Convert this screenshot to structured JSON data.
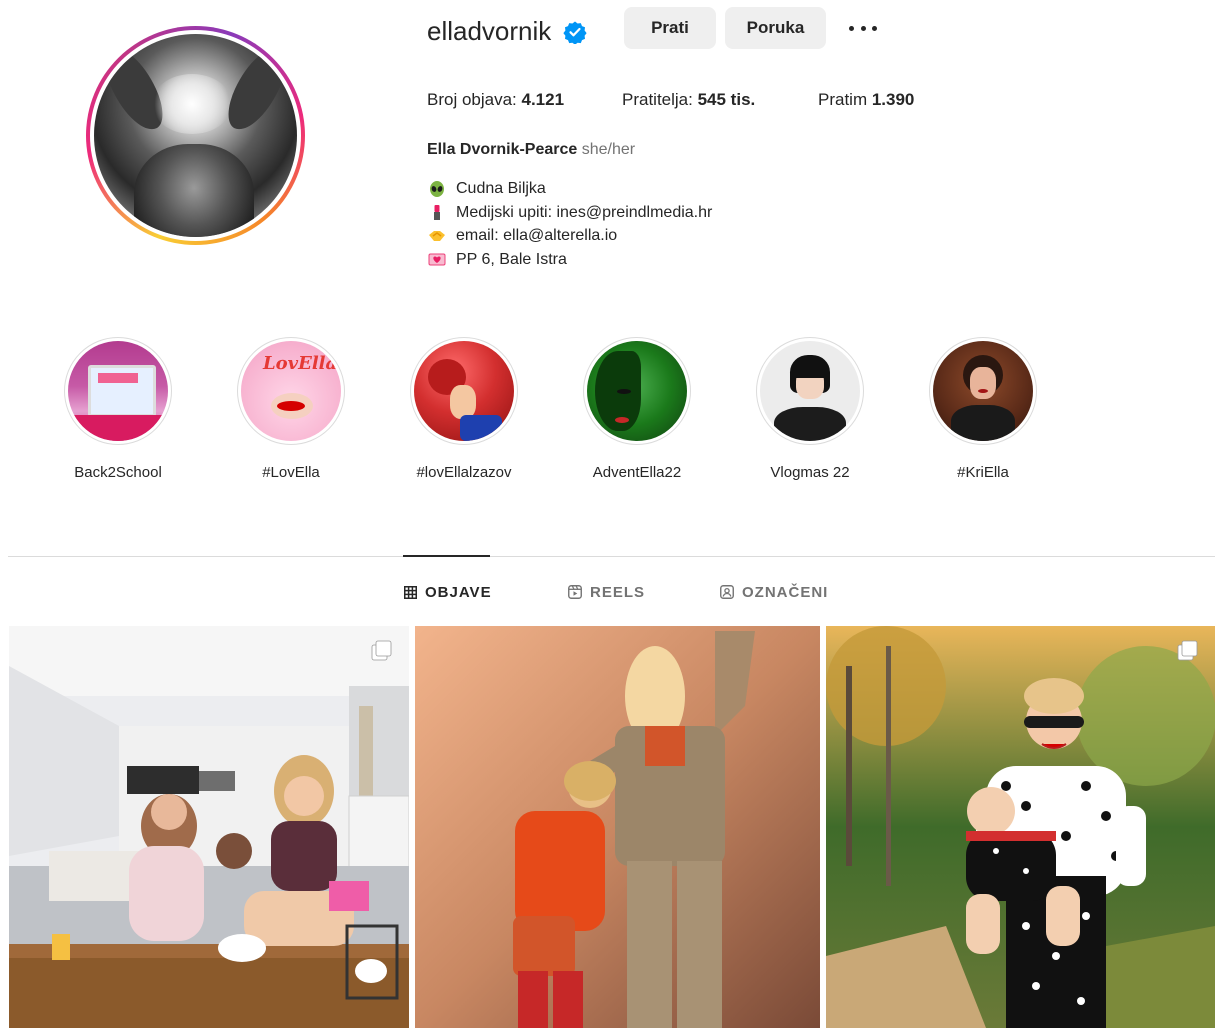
{
  "profile": {
    "username": "elladvornik",
    "verified": true,
    "follow_label": "Prati",
    "message_label": "Poruka",
    "more_label": "•••",
    "stats": {
      "posts_label": "Broj objava: ",
      "posts_value": "4.121",
      "followers_label": "Pratitelja: ",
      "followers_value": "545 tis.",
      "following_label": "Pratim ",
      "following_value": "1.390"
    },
    "full_name": "Ella Dvornik-Pearce",
    "pronouns": "she/her",
    "bio": [
      {
        "icon": "alien-icon",
        "text": "Cudna Biljka"
      },
      {
        "icon": "lipstick-icon",
        "text": "Medijski upiti: ines@preindlmedia.hr"
      },
      {
        "icon": "handshake-icon",
        "text": "email: ella@alterella.io"
      },
      {
        "icon": "heart-letter-icon",
        "text": "PP 6, Bale Istra"
      }
    ]
  },
  "highlights": [
    {
      "label": "Back2School"
    },
    {
      "label": "#LovElla"
    },
    {
      "label": "#lovEllalzazov"
    },
    {
      "label": "AdventElla22"
    },
    {
      "label": "Vlogmas 22"
    },
    {
      "label": "#KriElla"
    }
  ],
  "tabs": [
    {
      "label": "OBJAVE",
      "icon": "grid-icon",
      "active": true
    },
    {
      "label": "REELS",
      "icon": "reels-icon",
      "active": false
    },
    {
      "label": "OZNAČENI",
      "icon": "tagged-icon",
      "active": false
    }
  ],
  "colors": {
    "button_bg": "#efefef",
    "verified_blue": "#0095f6",
    "text_primary": "#262626",
    "text_secondary": "#737373",
    "divider": "#dbdbdb"
  }
}
